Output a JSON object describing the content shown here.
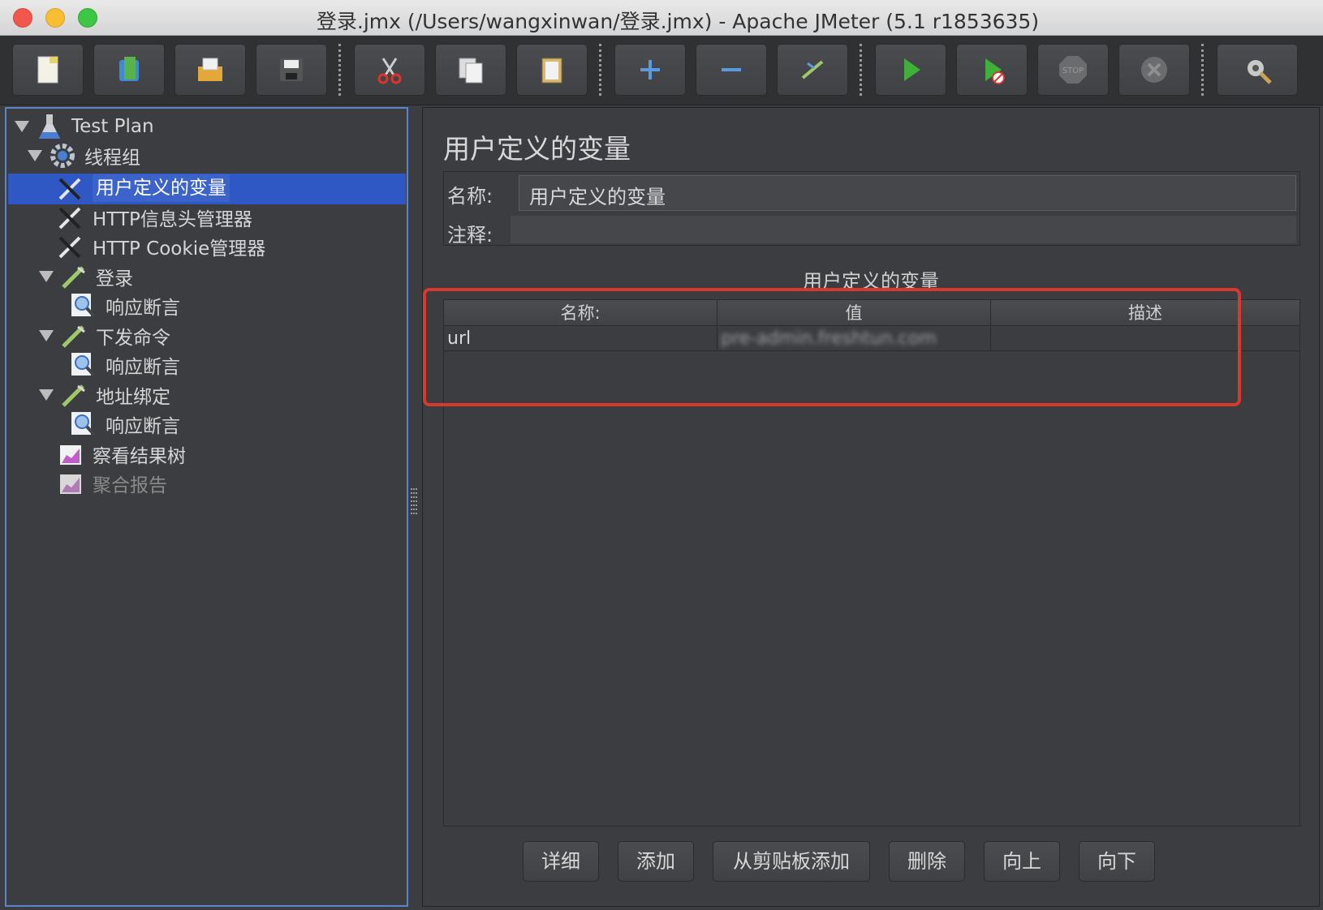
{
  "window": {
    "title": "登录.jmx (/Users/wangxinwan/登录.jmx) - Apache JMeter (5.1 r1853635)"
  },
  "toolbar": {
    "buttons": [
      {
        "name": "new-icon"
      },
      {
        "name": "templates-icon"
      },
      {
        "name": "open-icon"
      },
      {
        "name": "save-icon"
      },
      {
        "name": "cut-icon"
      },
      {
        "name": "copy-icon"
      },
      {
        "name": "paste-icon"
      },
      {
        "name": "expand-icon"
      },
      {
        "name": "collapse-icon"
      },
      {
        "name": "toggle-icon"
      },
      {
        "name": "start-icon"
      },
      {
        "name": "start-no-pause-icon"
      },
      {
        "name": "stop-icon"
      },
      {
        "name": "shutdown-icon"
      },
      {
        "name": "clear-icon"
      }
    ],
    "stop_text": "STOP"
  },
  "tree": {
    "items": [
      {
        "label": "Test Plan",
        "icon": "flask-icon",
        "expanded": true
      },
      {
        "label": "线程组",
        "icon": "gear-icon",
        "expanded": true
      },
      {
        "label": "用户定义的变量",
        "icon": "wrench-icon",
        "selected": true
      },
      {
        "label": "HTTP信息头管理器",
        "icon": "wrench-icon"
      },
      {
        "label": "HTTP Cookie管理器",
        "icon": "wrench-icon"
      },
      {
        "label": "登录",
        "icon": "sampler-icon",
        "expanded": true
      },
      {
        "label": "响应断言",
        "icon": "magnifier-icon"
      },
      {
        "label": "下发命令",
        "icon": "sampler-icon",
        "expanded": true
      },
      {
        "label": "响应断言",
        "icon": "magnifier-icon"
      },
      {
        "label": "地址绑定",
        "icon": "sampler-icon",
        "expanded": true
      },
      {
        "label": "响应断言",
        "icon": "magnifier-icon"
      },
      {
        "label": "察看结果树",
        "icon": "graph-icon"
      },
      {
        "label": "聚合报告",
        "icon": "graph-icon",
        "disabled": true
      }
    ]
  },
  "panel": {
    "title": "用户定义的变量",
    "name_label": "名称:",
    "name_value": "用户定义的变量",
    "comment_label": "注释:",
    "table_caption": "用户定义的变量",
    "table": {
      "headers": [
        "名称:",
        "值",
        "描述"
      ],
      "rows": [
        {
          "name": "url",
          "value": "pre-admin.freshtun.com",
          "description": ""
        }
      ]
    },
    "buttons": {
      "detail": "详细",
      "add": "添加",
      "add_clipboard": "从剪贴板添加",
      "delete": "删除",
      "up": "向上",
      "down": "向下"
    }
  },
  "colors": {
    "highlight": "#d8382e",
    "selection": "#2f58c4",
    "accent_border": "#5a86c8"
  }
}
